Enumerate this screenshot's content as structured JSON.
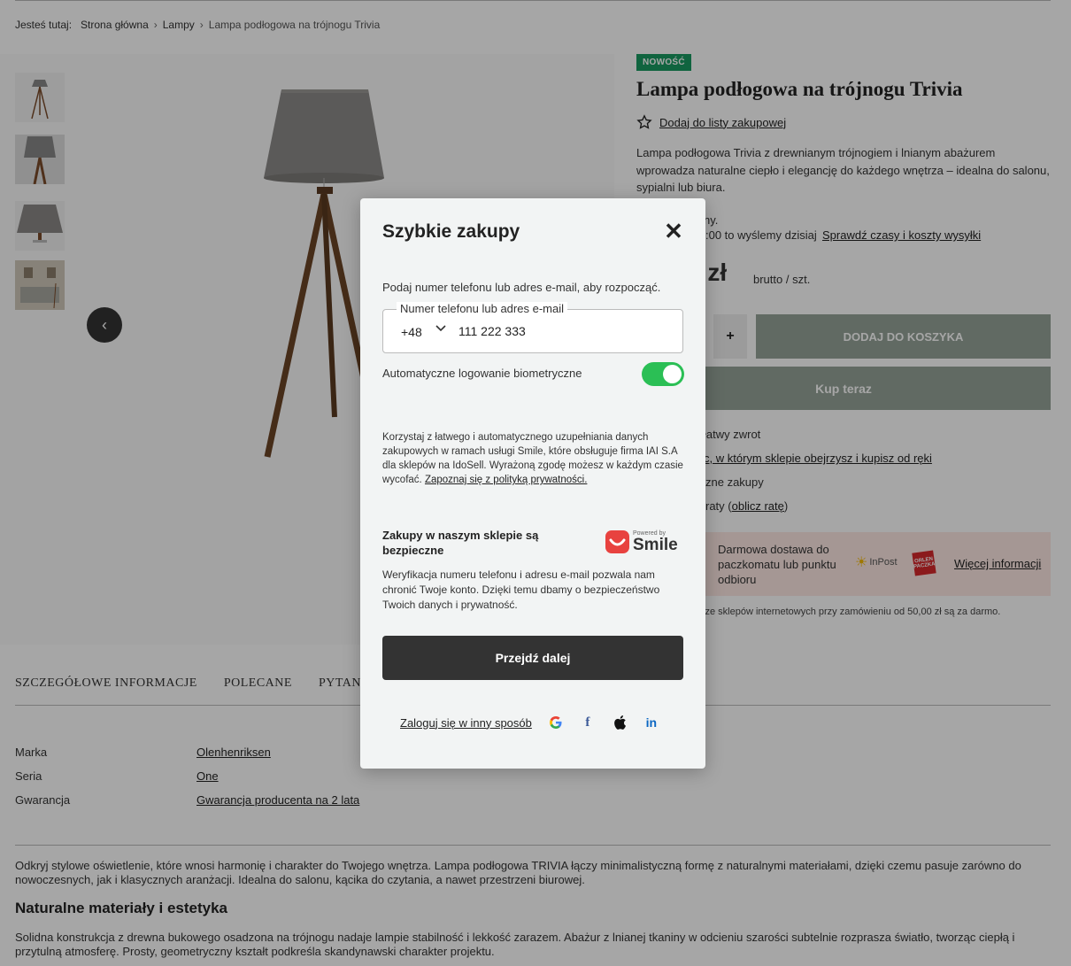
{
  "breadcrumb": {
    "prefix": "Jesteś tutaj:",
    "items": [
      "Strona główna",
      "Lampy",
      "Lampa podłogowa na trójnogu Trivia"
    ]
  },
  "product": {
    "badge": "NOWOŚĆ",
    "title": "Lampa podłogowa na trójnogu Trivia",
    "wishlist_label": "Dodaj do listy zakupowej",
    "description": "Lampa podłogowa Trivia z drewnianym trójnogiem i lnianym abażurem wprowadza naturalne ciepło i elegancję do każdego wnętrza – idealna do salonu, sypialni lub biura.",
    "availability_fragment": "ny.",
    "shipping_fragment": ":00 to wyślemy dzisiaj",
    "shipping_link": "Sprawdź czasy i koszty wysyłki",
    "price_fragment": "0 zł",
    "price_unit": "brutto / szt.",
    "add_to_cart": "DODAJ DO KOSZYKA",
    "buy_now": "Kup teraz",
    "info_return": "łatwy zwrot",
    "info_store_link": "c, w którym sklepie obejrzysz i kupisz od ręki",
    "info_shopping": "zne zakupy",
    "info_installments_prefix": "raty (",
    "info_installments_link": "oblicz ratę",
    "info_installments_suffix": ")",
    "delivery_text": "Darmowa dostawa do paczkomatu lub punktu odbioru",
    "delivery_inpost": "InPost",
    "delivery_orlen": "ORLEN PACZKA",
    "delivery_more": "Więcej informacji",
    "delivery_note": "wy ze sklepów internetowych przy zamówieniu od 50,00 zł są za darmo."
  },
  "tabs": [
    "SZCZEGÓŁOWE INFORMACJE",
    "POLECANE",
    "PYTANIA IN"
  ],
  "attributes": [
    {
      "label": "Marka",
      "value": "Olenhenriksen"
    },
    {
      "label": "Seria",
      "value": "One"
    },
    {
      "label": "Gwarancja",
      "value": "Gwarancja producenta na 2 lata"
    }
  ],
  "content": {
    "intro": "Odkryj stylowe oświetlenie, które wnosi harmonię i charakter do Twojego wnętrza. Lampa podłogowa TRIVIA łączy minimalistyczną formę z naturalnymi materiałami, dzięki czemu pasuje zarówno do nowoczesnych, jak i klasycznych aranżacji. Idealna do salonu, kącika do czytania, a nawet przestrzeni biurowej.",
    "heading": "Naturalne materiały i estetyka",
    "body": "Solidna konstrukcja z drewna bukowego osadzona na trójnogu nadaje lampie stabilność i lekkość zarazem. Abażur z lnianej tkaniny w odcieniu szarości subtelnie rozprasza światło, tworząc ciepłą i przytulną atmosferę. Prosty, geometryczny kształt podkreśla skandynawski charakter projektu."
  },
  "modal": {
    "title": "Szybkie zakupy",
    "intro": "Podaj numer telefonu lub adres e-mail, aby rozpocząć.",
    "field_label": "Numer telefonu lub adres e-mail",
    "country_prefix": "+48",
    "phone_value": "111 222 333",
    "biometric_label": "Automatyczne logowanie biometryczne",
    "biometric_on": true,
    "smile_text": "Korzystaj z łatwego i automatycznego uzupełniania danych zakupowych w ramach usługi Smile, które obsługuje firma IAI S.A dla sklepów na IdoSell. Wyrażoną zgodę możesz w każdym czasie wycofać.",
    "privacy_link": "Zapoznaj się z polityką prywatności.",
    "safe_title": "Zakupy w naszym sklepie są bezpieczne",
    "powered_by": "Powered by",
    "smile_brand": "Smile",
    "verify_text": "Weryfikacja numeru telefonu i adresu e-mail pozwala nam chronić Twoje konto. Dzięki temu dbamy o bezpieczeństwo Twoich danych i prywatność.",
    "next_button": "Przejdź dalej",
    "other_login": "Zaloguj się w inny sposób",
    "social": [
      "google-icon",
      "facebook-icon",
      "apple-icon",
      "linkedin-icon"
    ]
  },
  "colors": {
    "badge": "#1a9a62",
    "toggle_on": "#2bbf55",
    "primary_dark": "#333333",
    "cart_button": "#95a398",
    "delivery_bg": "#fde9e4"
  }
}
